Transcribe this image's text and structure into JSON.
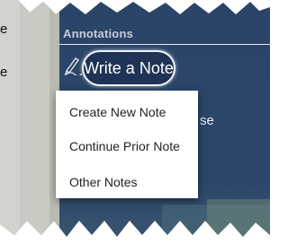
{
  "left_panel_fragments": [
    "e",
    "e"
  ],
  "annotations": {
    "header": "Annotations",
    "write_note_label": "Write a Note",
    "pencil_icon": "pencil-icon"
  },
  "partial_texts": [
    "se"
  ],
  "menu": {
    "items": [
      "Create New Note",
      "Continue Prior Note",
      "Other Notes"
    ]
  },
  "colors": {
    "panel_navy": "#2a4568",
    "button_navy": "#1e3355",
    "left_panel_gray": "#c9cac4"
  }
}
